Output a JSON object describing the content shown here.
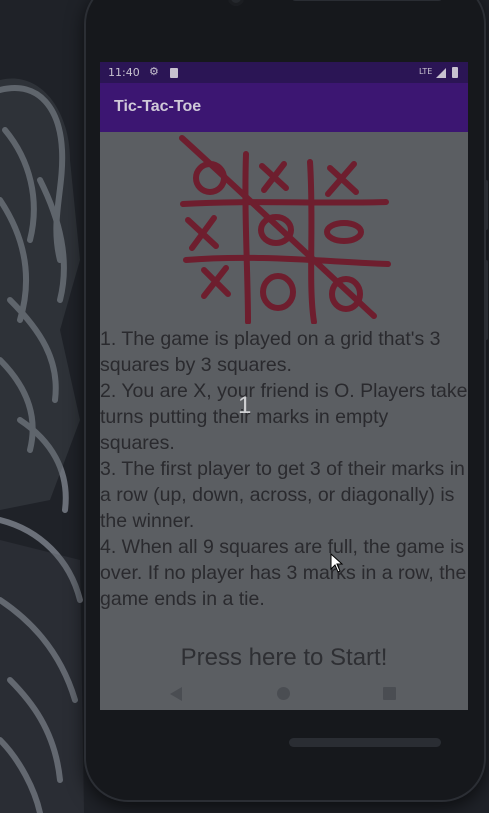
{
  "status_bar": {
    "time": "11:40",
    "network": "LTE",
    "icons": [
      "gear-icon",
      "sd-card-icon",
      "signal-icon",
      "battery-icon"
    ]
  },
  "app_bar": {
    "title": "Tic-Tac-Toe",
    "color": "#3c1672"
  },
  "board_image": {
    "marks": [
      [
        "O",
        "X",
        "X"
      ],
      [
        "X",
        "O",
        "O"
      ],
      [
        "X",
        "O",
        "O"
      ]
    ],
    "ink_color": "#6e1e2e"
  },
  "instructions": [
    "1. The game is played on a grid that's 3 squares by 3 squares.",
    "2. You are X, your friend is O. Players take turns putting their marks in empty squares.",
    "3. The first player to get 3 of their marks in a row (up, down, across, or diagonally) is the winner.",
    "4. When all 9 squares are full, the game is over. If no player has 3 marks in a row, the game ends in a tie."
  ],
  "toast_text": "1",
  "start_button_label": "Press here to Start!",
  "nav_bar": {
    "icons": [
      "back-icon",
      "home-icon",
      "recents-icon"
    ]
  }
}
